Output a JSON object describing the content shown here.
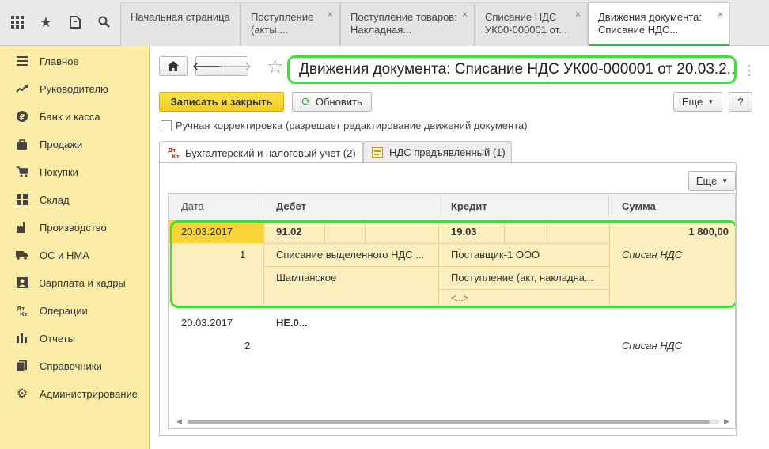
{
  "topbar": {
    "tabs": [
      {
        "label": "Начальная страница"
      },
      {
        "label": "Поступление (акты,..."
      },
      {
        "label": "Поступление товаров: Накладная..."
      },
      {
        "label": "Списание НДС УК00-000001 от..."
      },
      {
        "label": "Движения документа: Списание НДС..."
      }
    ],
    "close_glyph": "×"
  },
  "sidebar": {
    "items": [
      {
        "label": "Главное",
        "icon": "menu-icon"
      },
      {
        "label": "Руководителю",
        "icon": "trend-icon"
      },
      {
        "label": "Банк и касса",
        "icon": "ruble-icon"
      },
      {
        "label": "Продажи",
        "icon": "bag-icon"
      },
      {
        "label": "Покупки",
        "icon": "cart-icon"
      },
      {
        "label": "Склад",
        "icon": "warehouse-icon"
      },
      {
        "label": "Производство",
        "icon": "factory-icon"
      },
      {
        "label": "ОС и НМА",
        "icon": "truck-icon"
      },
      {
        "label": "Зарплата и кадры",
        "icon": "people-icon"
      },
      {
        "label": "Операции",
        "icon": "dt-kt-icon"
      },
      {
        "label": "Отчеты",
        "icon": "chart-icon"
      },
      {
        "label": "Справочники",
        "icon": "book-icon"
      },
      {
        "label": "Администрирование",
        "icon": "gear-icon"
      }
    ]
  },
  "header": {
    "title": "Движения документа: Списание НДС УК00-000001 от 20.03.2...",
    "save_close_label": "Записать и закрыть",
    "refresh_label": "Обновить",
    "more_label": "Еще",
    "help_label": "?",
    "manual_edit_label": "Ручная корректировка (разрешает редактирование движений документа)"
  },
  "doc_tabs": [
    {
      "label": "Бухгалтерский и налоговый учет (2)",
      "active": true
    },
    {
      "label": "НДС предъявленный (1)",
      "active": false
    }
  ],
  "panel": {
    "more_label": "Еще",
    "columns": [
      "Дата",
      "Дебет",
      "Кредит",
      "Сумма"
    ],
    "rows": [
      {
        "date": "20.03.2017",
        "line": "1",
        "debit_account": "91.02",
        "debit_sub1": "Списание выделенного НДС ...",
        "debit_sub2": "Шампанское",
        "credit_account": "19.03",
        "credit_sub1": "Поставщик-1 ООО",
        "credit_sub2": "Поступление (акт, накладна...",
        "credit_sub3": "<...>",
        "amount": "1 800,00",
        "content": "Списан НДС"
      },
      {
        "date": "20.03.2017",
        "line": "2",
        "debit_account": "НЕ.0...",
        "content": "Списан НДС"
      }
    ]
  },
  "colors": {
    "sidebar_bg": "#fbeca7",
    "accent_yellow": "#f8d439",
    "highlight_green": "#3dde3d",
    "row_highlight": "#fbf0bd"
  }
}
